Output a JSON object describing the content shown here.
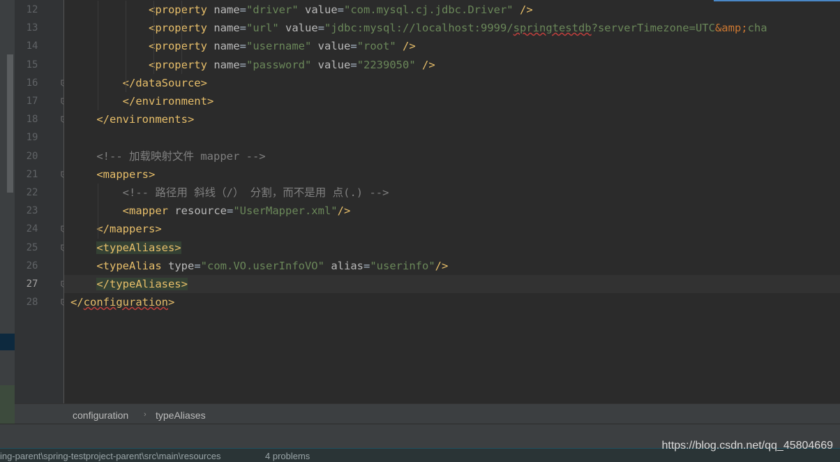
{
  "editor": {
    "lines": [
      {
        "num": "12",
        "indent": "            ",
        "parts": [
          [
            "tag",
            "<property"
          ],
          [
            "plain",
            " "
          ],
          [
            "attr",
            "name"
          ],
          [
            "eq",
            "="
          ],
          [
            "val",
            "\"driver\""
          ],
          [
            "plain",
            " "
          ],
          [
            "attr",
            "value"
          ],
          [
            "eq",
            "="
          ],
          [
            "val",
            "\"com.mysql.cj.jdbc.Driver\""
          ],
          [
            "plain",
            " "
          ],
          [
            "tag",
            "/>"
          ]
        ]
      },
      {
        "num": "13",
        "indent": "            ",
        "parts": [
          [
            "tag",
            "<property"
          ],
          [
            "plain",
            " "
          ],
          [
            "attr",
            "name"
          ],
          [
            "eq",
            "="
          ],
          [
            "val",
            "\"url\""
          ],
          [
            "plain",
            " "
          ],
          [
            "attr",
            "value"
          ],
          [
            "eq",
            "="
          ],
          [
            "val",
            "\"jdbc:mysql://localhost:9999/"
          ],
          [
            "valsq",
            "springtestdb"
          ],
          [
            "val",
            "?serverTimezone=UTC"
          ],
          [
            "ent",
            "&amp;"
          ],
          [
            "val",
            "cha"
          ]
        ]
      },
      {
        "num": "14",
        "indent": "            ",
        "parts": [
          [
            "tag",
            "<property"
          ],
          [
            "plain",
            " "
          ],
          [
            "attr",
            "name"
          ],
          [
            "eq",
            "="
          ],
          [
            "val",
            "\"username\""
          ],
          [
            "plain",
            " "
          ],
          [
            "attr",
            "value"
          ],
          [
            "eq",
            "="
          ],
          [
            "val",
            "\"root\""
          ],
          [
            "plain",
            " "
          ],
          [
            "tag",
            "/>"
          ]
        ]
      },
      {
        "num": "15",
        "indent": "            ",
        "parts": [
          [
            "tag",
            "<property"
          ],
          [
            "plain",
            " "
          ],
          [
            "attr",
            "name"
          ],
          [
            "eq",
            "="
          ],
          [
            "val",
            "\"password\""
          ],
          [
            "plain",
            " "
          ],
          [
            "attr",
            "value"
          ],
          [
            "eq",
            "="
          ],
          [
            "val",
            "\"2239050\""
          ],
          [
            "plain",
            " "
          ],
          [
            "tag",
            "/>"
          ]
        ]
      },
      {
        "num": "16",
        "indent": "        ",
        "parts": [
          [
            "tag",
            "</dataSource>"
          ]
        ]
      },
      {
        "num": "17",
        "indent": "        ",
        "parts": [
          [
            "tag",
            "</environment>"
          ]
        ]
      },
      {
        "num": "18",
        "indent": "    ",
        "parts": [
          [
            "tag",
            "</environments>"
          ]
        ]
      },
      {
        "num": "19",
        "indent": "",
        "parts": []
      },
      {
        "num": "20",
        "indent": "    ",
        "parts": [
          [
            "comment",
            "<!-- 加载映射文件 mapper -->"
          ]
        ]
      },
      {
        "num": "21",
        "indent": "    ",
        "parts": [
          [
            "tag",
            "<mappers>"
          ]
        ]
      },
      {
        "num": "22",
        "indent": "        ",
        "parts": [
          [
            "comment",
            "<!-- 路径用 斜线（/） 分割，而不是用 点(.) -->"
          ]
        ]
      },
      {
        "num": "23",
        "indent": "        ",
        "parts": [
          [
            "tag",
            "<mapper"
          ],
          [
            "plain",
            " "
          ],
          [
            "attr",
            "resource"
          ],
          [
            "eq",
            "="
          ],
          [
            "val",
            "\"UserMapper.xml\""
          ],
          [
            "tag",
            "/>"
          ]
        ]
      },
      {
        "num": "24",
        "indent": "    ",
        "parts": [
          [
            "tag",
            "</mappers>"
          ]
        ]
      },
      {
        "num": "25",
        "indent": "    ",
        "parts": [
          [
            "taghl",
            "<typeAliases>"
          ]
        ]
      },
      {
        "num": "26",
        "indent": "    ",
        "parts": [
          [
            "tag",
            "<typeAlias"
          ],
          [
            "plain",
            " "
          ],
          [
            "attr",
            "type"
          ],
          [
            "eq",
            "="
          ],
          [
            "val",
            "\"com.VO.userInfoVO\""
          ],
          [
            "plain",
            " "
          ],
          [
            "attr",
            "alias"
          ],
          [
            "eq",
            "="
          ],
          [
            "val",
            "\"userinfo\""
          ],
          [
            "tag",
            "/>"
          ]
        ]
      },
      {
        "num": "27",
        "indent": "    ",
        "parts": [
          [
            "taghl",
            "</typeAliases>"
          ]
        ],
        "current": true
      },
      {
        "num": "28",
        "indent": "",
        "parts": [
          [
            "tag",
            "</"
          ],
          [
            "tagsq",
            "configuration"
          ],
          [
            "tag",
            ">"
          ]
        ]
      }
    ],
    "fold_markers": [
      "16",
      "17",
      "18",
      "21",
      "24",
      "25",
      "27",
      "28"
    ]
  },
  "breadcrumb": {
    "items": [
      "configuration",
      "typeAliases"
    ],
    "separator": "›"
  },
  "status_bar": {
    "path": "ing-parent\\spring-testproject-parent\\src\\main\\resources",
    "problems": "4 problems"
  },
  "watermark": "https://blog.csdn.net/qq_45804669",
  "colors": {
    "tag": "#e8bf6a",
    "attribute": "#bababa",
    "value": "#6a8759",
    "comment": "#808080",
    "background": "#2b2b2b",
    "accent": "#4a88c7"
  }
}
